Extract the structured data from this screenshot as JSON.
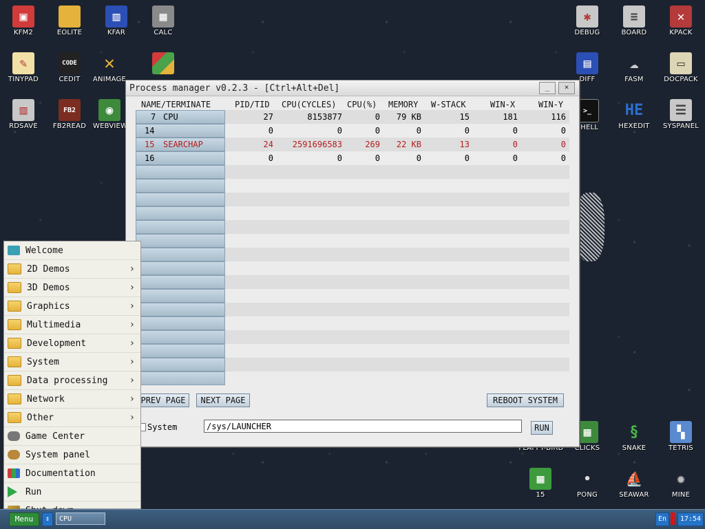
{
  "desktop": {
    "icons": [
      {
        "label": "KFM2",
        "icon": "floppy-icon",
        "color": "#d13b3b"
      },
      {
        "label": "EOLITE",
        "icon": "folder-icon",
        "color": "#e5b33b"
      },
      {
        "label": "KFAR",
        "icon": "panels-icon",
        "color": "#2b4fb5"
      },
      {
        "label": "CALC",
        "icon": "calculator-icon",
        "color": "#8a8a8a"
      },
      {
        "label": "DEBUG",
        "icon": "bug-icon",
        "color": "#c8c8c8"
      },
      {
        "label": "BOARD",
        "icon": "board-icon",
        "color": "#c8c8c8"
      },
      {
        "label": "KPACK",
        "icon": "wrench-icon",
        "color": "#b53a3a"
      },
      {
        "label": "TINYPAD",
        "icon": "notepad-icon",
        "color": "#f2e1a6"
      },
      {
        "label": "CEDIT",
        "icon": "code-icon",
        "color": "#222222"
      },
      {
        "label": "ANIMAGE",
        "icon": "brush-icon",
        "color": "#e5b33b"
      },
      {
        "label": "",
        "icon": "cube-icon",
        "color": "#4aa24a"
      },
      {
        "label": "DIFF",
        "icon": "diff-icon",
        "color": "#2b4fb5"
      },
      {
        "label": "FASM",
        "icon": "fasm-icon",
        "color": "#bbbbbb"
      },
      {
        "label": "DOCPACK",
        "icon": "docpack-icon",
        "color": "#dcd6b4"
      },
      {
        "label": "RDSAVE",
        "icon": "rdsave-icon",
        "color": "#c8c8c8"
      },
      {
        "label": "FB2READ",
        "icon": "book-icon",
        "color": "#7a2d20"
      },
      {
        "label": "WEBVIEW",
        "icon": "globe-icon",
        "color": "#3d8a3d"
      },
      {
        "label": "SHELL",
        "icon": "terminal-icon",
        "color": "#111111"
      },
      {
        "label": "HEXEDIT",
        "icon": "hex-icon",
        "color": "#2b6fd0"
      },
      {
        "label": "SYSPANEL",
        "icon": "sliders-icon",
        "color": "#c8c8c8"
      },
      {
        "label": "FLAPPY-BIRD",
        "icon": "",
        "color": ""
      },
      {
        "label": "CLICKS",
        "icon": "clicks-icon",
        "color": "#3d8a3d"
      },
      {
        "label": "SNAKE",
        "icon": "snake-icon",
        "color": "#3d8a3d"
      },
      {
        "label": "TETRIS",
        "icon": "tetris-icon",
        "color": "#5a8ad0"
      },
      {
        "label": "15",
        "icon": "fifteen-icon",
        "color": "#3d9a3d"
      },
      {
        "label": "PONG",
        "icon": "pong-icon",
        "color": "#dddddd"
      },
      {
        "label": "SEAWAR",
        "icon": "ship-icon",
        "color": "#dddddd"
      },
      {
        "label": "MINE",
        "icon": "mine-icon",
        "color": "#555555"
      }
    ]
  },
  "window": {
    "title": "Process manager v0.2.3 - [Ctrl+Alt+Del]",
    "columns": [
      "NAME/TERMINATE",
      "PID/TID",
      "CPU(CYCLES)",
      "CPU(%)",
      "MEMORY",
      "W-STACK",
      "WIN-X",
      "WIN-Y"
    ],
    "rows": [
      {
        "slot": "7",
        "name": "CPU",
        "pid": "27",
        "cycles": "8153877",
        "cpu": "0",
        "memory": "79 KB",
        "wstack": "15",
        "winx": "181",
        "winy": "116",
        "highlight": false
      },
      {
        "slot": "14",
        "name": "",
        "pid": "0",
        "cycles": "0",
        "cpu": "0",
        "memory": "0",
        "wstack": "0",
        "winx": "0",
        "winy": "0",
        "highlight": false
      },
      {
        "slot": "15",
        "name": "SEARCHAP",
        "pid": "24",
        "cycles": "2591696583",
        "cpu": "269",
        "memory": "22 KB",
        "wstack": "13",
        "winx": "0",
        "winy": "0",
        "highlight": true
      },
      {
        "slot": "16",
        "name": "",
        "pid": "0",
        "cycles": "0",
        "cpu": "0",
        "memory": "0",
        "wstack": "0",
        "winx": "0",
        "winy": "0",
        "highlight": false
      }
    ],
    "prev_page": "PREV PAGE",
    "next_page": "NEXT PAGE",
    "reboot": "REBOOT SYSTEM",
    "system_label": "System",
    "path_value": "/sys/LAUNCHER",
    "run": "RUN"
  },
  "menu": {
    "items": [
      {
        "label": "Welcome",
        "icon": "bird-icon",
        "submenu": false
      },
      {
        "label": "2D Demos",
        "icon": "folder-icon",
        "submenu": true
      },
      {
        "label": "3D Demos",
        "icon": "folder-icon",
        "submenu": true
      },
      {
        "label": "Graphics",
        "icon": "folder-icon",
        "submenu": true
      },
      {
        "label": "Multimedia",
        "icon": "folder-icon",
        "submenu": true
      },
      {
        "label": "Development",
        "icon": "folder-icon",
        "submenu": true
      },
      {
        "label": "System",
        "icon": "folder-icon",
        "submenu": true
      },
      {
        "label": "Data processing",
        "icon": "folder-icon",
        "submenu": true
      },
      {
        "label": "Network",
        "icon": "folder-icon",
        "submenu": true
      },
      {
        "label": "Other",
        "icon": "folder-icon",
        "submenu": true
      },
      {
        "label": "Game Center",
        "icon": "gamepad-icon",
        "submenu": false
      },
      {
        "label": "System panel",
        "icon": "gears-icon",
        "submenu": false
      },
      {
        "label": "Documentation",
        "icon": "books-icon",
        "submenu": false
      },
      {
        "label": "Run",
        "icon": "play-icon",
        "submenu": false
      },
      {
        "label": "Shut down",
        "icon": "wand-icon",
        "submenu": false
      }
    ]
  },
  "taskbar": {
    "menu_label": "Menu",
    "task": "CPU",
    "lang": "En",
    "clock": "17:54"
  }
}
